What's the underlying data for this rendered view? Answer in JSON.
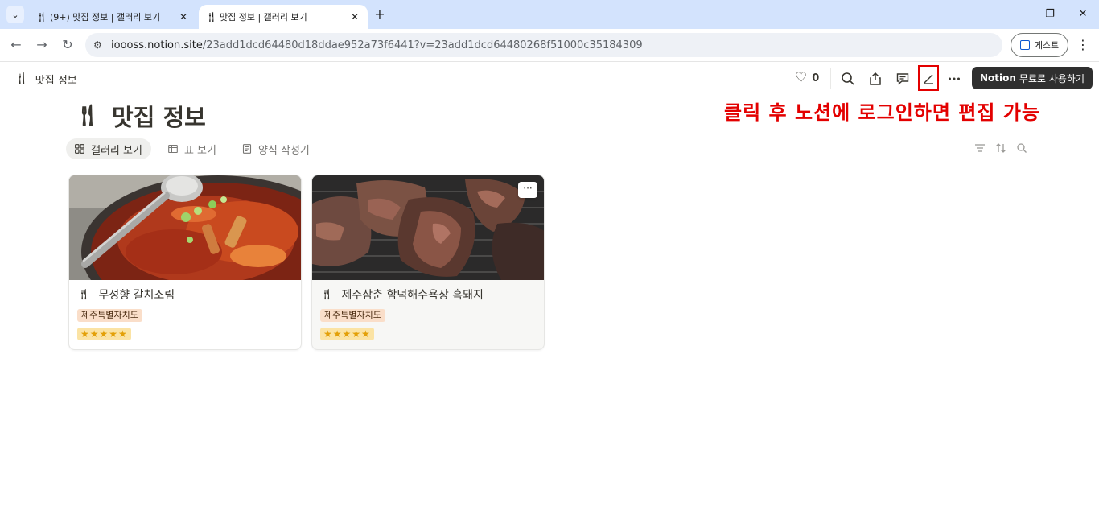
{
  "browser": {
    "tabs": [
      {
        "title": "(9+) 맛집 정보 | 갤러리 보기",
        "active": false
      },
      {
        "title": "맛집 정보 | 갤러리 보기",
        "active": true
      }
    ],
    "url_host": "ioooss.notion.site",
    "url_path": "/23add1dcd64480d18ddae952a73f6441?v=23add1dcd64480268f51000c35184309",
    "profile_label": "게스트"
  },
  "topbar": {
    "breadcrumb": "맛집 정보",
    "likes_count": "0",
    "try_notion_brand": "Notion",
    "try_notion_label": "무료로 사용하기"
  },
  "annotation": "클릭 후 노션에 로그인하면 편집 가능",
  "page": {
    "title": "맛집 정보",
    "views": [
      {
        "label": "갤러리 보기",
        "active": true,
        "icon": "gallery-icon"
      },
      {
        "label": "표 보기",
        "active": false,
        "icon": "table-icon"
      },
      {
        "label": "양식 작성기",
        "active": false,
        "icon": "form-icon"
      }
    ]
  },
  "cards": [
    {
      "name": "무성향 갈치조림",
      "region": "제주특별자치도",
      "rating": "★★★★★",
      "cover": "braised-hairtail-photo"
    },
    {
      "name": "제주삼춘 함덕해수욕장 흑돼지",
      "region": "제주특별자치도",
      "rating": "★★★★★",
      "cover": "grilled-black-pork-photo"
    }
  ],
  "colors": {
    "tabstrip": "#d3e3fd",
    "annotation_red": "#e30000",
    "tag_bg": "#fadec9",
    "rating_bg": "#fbe3a4"
  }
}
